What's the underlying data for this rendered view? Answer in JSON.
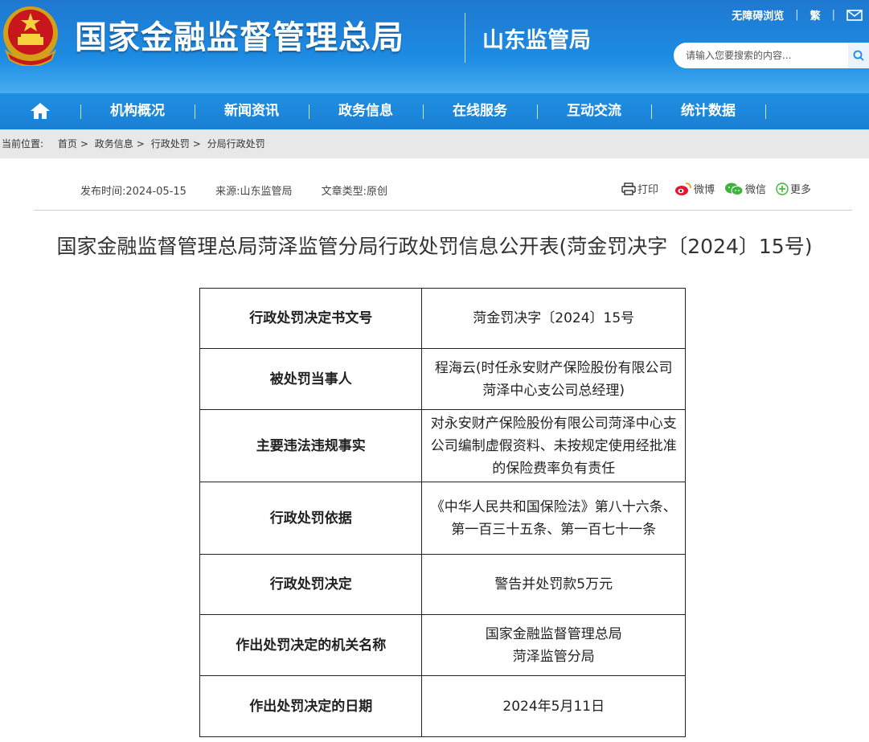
{
  "header": {
    "site_title": "国家金融监督管理总局",
    "sub_title": "山东监管局",
    "accessibility": "无障碍浏览",
    "traditional": "繁",
    "search_placeholder": "请输入您要搜索的内容...",
    "brand_color": "#1d8be2"
  },
  "nav": {
    "items": [
      "机构概况",
      "新闻资讯",
      "政务信息",
      "在线服务",
      "互动交流",
      "统计数据"
    ]
  },
  "breadcrumb": {
    "label": "当前位置:",
    "items": [
      "首页",
      "政务信息",
      "行政处罚",
      "分局行政处罚"
    ]
  },
  "meta": {
    "publish": "发布时间:2024-05-15",
    "source": "来源:山东监管局",
    "type": "文章类型:原创"
  },
  "share": {
    "print": "打印",
    "weibo": "微博",
    "wechat": "微信",
    "more": "更多"
  },
  "article": {
    "title": "国家金融监督管理总局菏泽监管分局行政处罚信息公开表(菏金罚决字〔2024〕15号)"
  },
  "table": {
    "rows": [
      {
        "label": "行政处罚决定书文号",
        "value": "菏金罚决字〔2024〕15号"
      },
      {
        "label": "被处罚当事人",
        "value": "程海云(时任永安财产保险股份有限公司菏泽中心支公司总经理)"
      },
      {
        "label": "主要违法违规事实",
        "value": "对永安财产保险股份有限公司菏泽中心支公司编制虚假资料、未按规定使用经批准的保险费率负有责任"
      },
      {
        "label": "行政处罚依据",
        "value": "《中华人民共和国保险法》第八十六条、第一百三十五条、第一百七十一条"
      },
      {
        "label": "行政处罚决定",
        "value": "警告并处罚款5万元"
      },
      {
        "label": "作出处罚决定的机关名称",
        "value": "国家金融监督管理总局\n菏泽监管分局"
      },
      {
        "label": "作出处罚决定的日期",
        "value": "2024年5月11日"
      }
    ]
  }
}
